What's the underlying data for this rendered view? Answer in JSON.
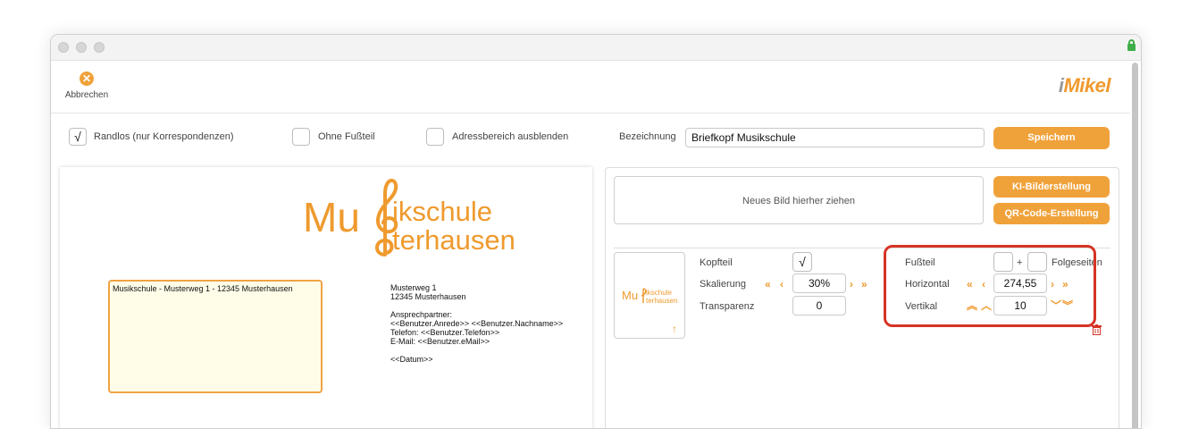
{
  "toolbar": {
    "cancel_label": "Abbrechen",
    "logo_i": "i",
    "logo_text": "Mikel"
  },
  "options": {
    "randlos": {
      "label": "Randlos (nur Korrespondenzen)",
      "checked": "√"
    },
    "ohne_fussteil": {
      "label": "Ohne Fußteil",
      "checked": ""
    },
    "adressbereich": {
      "label": "Adressbereich ausblenden",
      "checked": ""
    },
    "bezeichnung_label": "Bezeichnung",
    "bezeichnung_value": "Briefkopf Musikschule",
    "save_label": "Speichern"
  },
  "preview": {
    "logo_line1_a": "Mu",
    "logo_line1_b": "ikschule",
    "logo_line2": "terhausen",
    "address_line": "Musikschule - Musterweg 1 - 12345 Musterhausen",
    "sender_lines": [
      "Musterweg 1",
      "12345 Musterhausen",
      "",
      "Ansprechpartner:",
      "<<Benutzer.Anrede>> <<Benutzer.Nachname>>",
      "Telefon: <<Benutzer.Telefon>>",
      "E-Mail: <<Benutzer.eMail>>",
      "",
      "<<Datum>>"
    ]
  },
  "image_panel": {
    "dropzone_text": "Neues Bild hierher ziehen",
    "ki_button": "KI-Bilderstellung",
    "qr_button": "QR-Code-Erstellung",
    "thumb_text_a": "Mu",
    "thumb_text_b": "ikschule",
    "thumb_text_c": "terhausen",
    "kopfteil_label": "Kopfteil",
    "kopfteil_checked": "√",
    "skalierung_label": "Skalierung",
    "skalierung_value": "30%",
    "transparenz_label": "Transparenz",
    "transparenz_value": "0",
    "fussteil_label": "Fußteil",
    "plus": "+",
    "folgeseiten_label": "Folgeseiten",
    "horizontal_label": "Horizontal",
    "horizontal_value": "274,55",
    "vertikal_label": "Vertikal",
    "vertikal_value": "10"
  },
  "colors": {
    "accent": "#f0a23a",
    "highlight": "#d63326"
  }
}
